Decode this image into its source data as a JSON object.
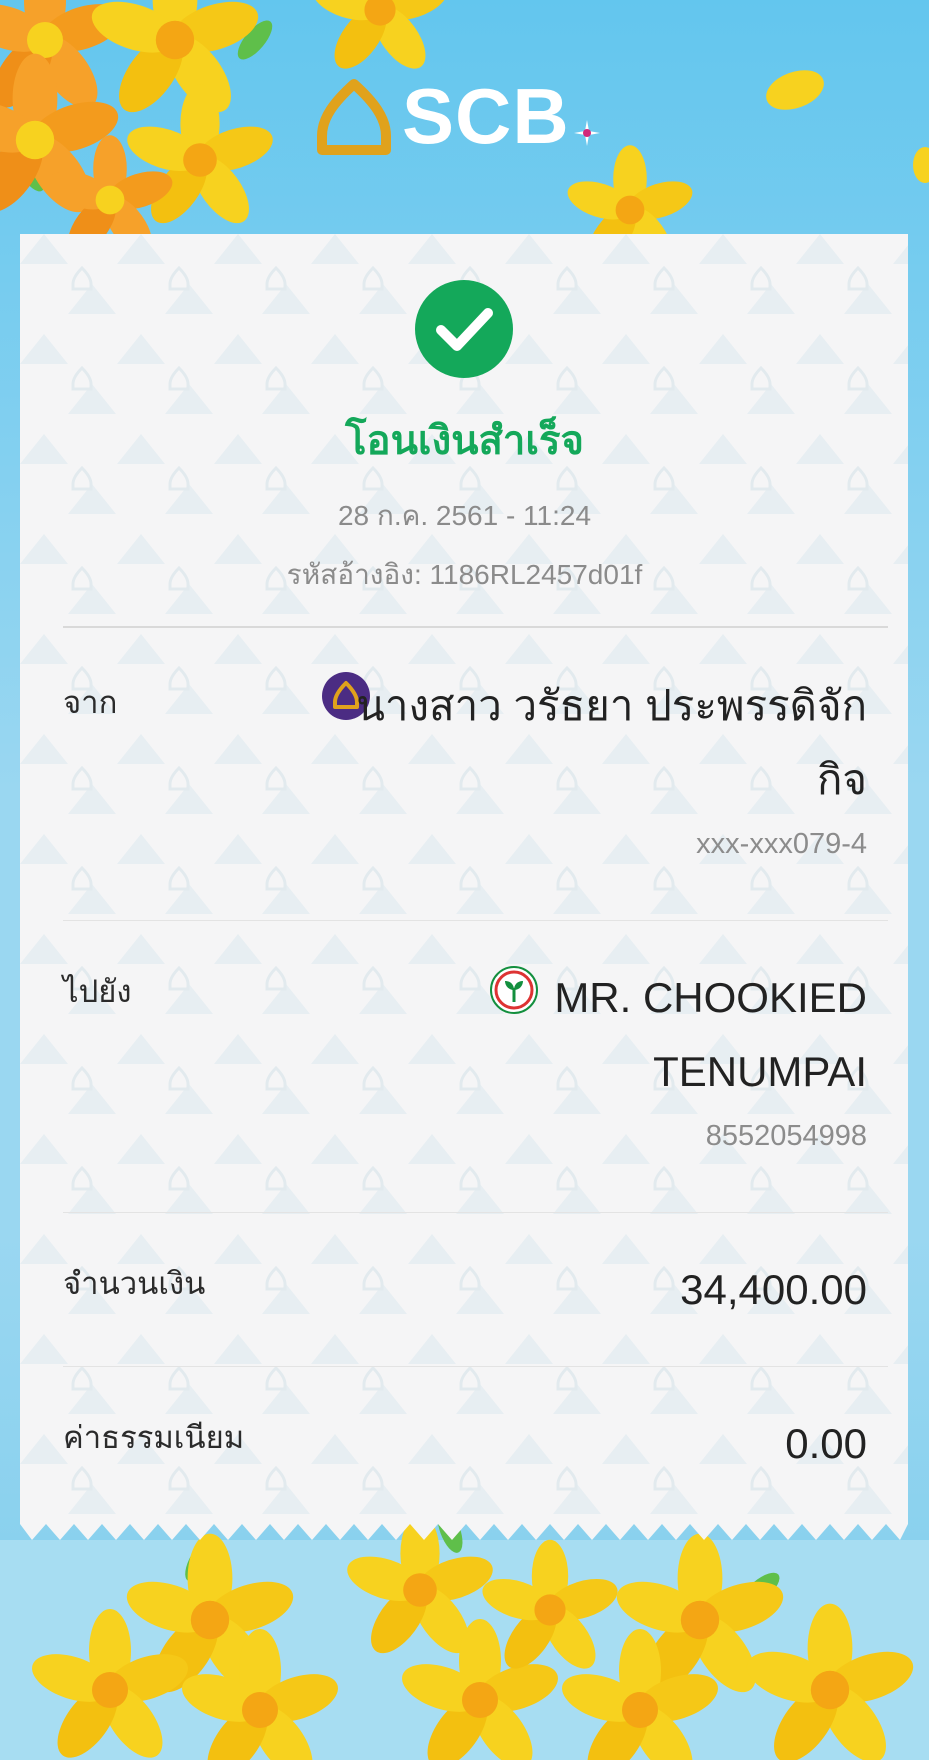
{
  "brand": {
    "name": "SCB"
  },
  "receipt": {
    "status_title": "โอนเงินสำเร็จ",
    "datetime": "28 ก.ค. 2561 - 11:24",
    "reference": "รหัสอ้างอิง: 1186RL2457d01f",
    "from": {
      "label": "จาก",
      "name_line1": "นางสาว วรัธยา ประพรรดิจัก",
      "name_line2": "กิจ",
      "account": "xxx-xxx079-4",
      "bank_icon": "scb-bank-icon"
    },
    "to": {
      "label": "ไปยัง",
      "name_line1": "MR. CHOOKIED",
      "name_line2": "TENUMPAI",
      "account": "8552054998",
      "bank_icon": "kbank-bank-icon"
    },
    "amount": {
      "label": "จำนวนเงิน",
      "value": "34,400.00"
    },
    "fee": {
      "label": "ค่าธรรมเนียม",
      "value": "0.00"
    }
  },
  "colors": {
    "success_green": "#14a85a",
    "scb_purple": "#4b2c83",
    "scb_gold": "#e0a21c",
    "kbank_green": "#138f3e",
    "sky": "#63c6ee"
  }
}
